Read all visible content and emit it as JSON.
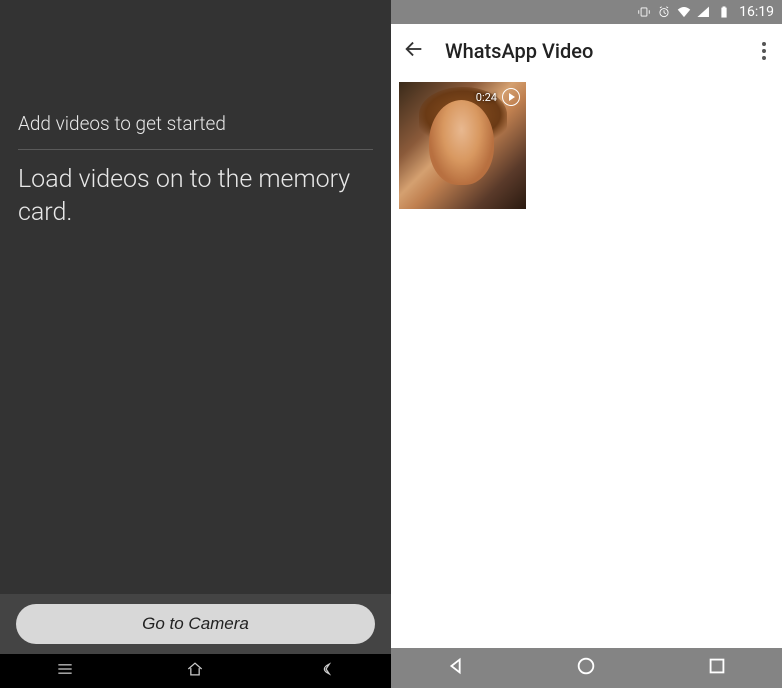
{
  "left": {
    "heading": "Add videos to get started",
    "subheading": "Load videos on to the memory card.",
    "camera_button": "Go to Camera"
  },
  "right": {
    "status": {
      "time": "16:19"
    },
    "title": "WhatsApp Video",
    "video": {
      "duration": "0:24"
    }
  }
}
